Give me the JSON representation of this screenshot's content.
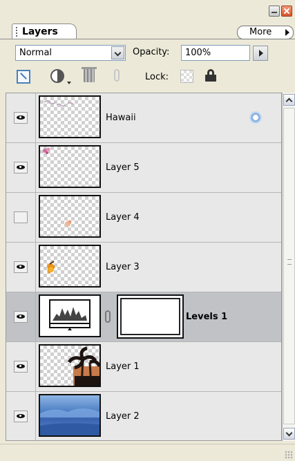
{
  "panel": {
    "tab_label": "Layers",
    "menu_label": "More"
  },
  "options": {
    "blend_mode": "Normal",
    "opacity_label": "Opacity:",
    "opacity_value": "100%",
    "lock_label": "Lock:"
  },
  "layers": [
    {
      "name": "Hawaii",
      "visible": true,
      "selected": false
    },
    {
      "name": "Layer 5",
      "visible": true,
      "selected": false
    },
    {
      "name": "Layer 4",
      "visible": false,
      "selected": false
    },
    {
      "name": "Layer 3",
      "visible": true,
      "selected": false
    },
    {
      "name": "Levels 1",
      "visible": true,
      "selected": true
    },
    {
      "name": "Layer 1",
      "visible": true,
      "selected": false
    },
    {
      "name": "Layer 2",
      "visible": true,
      "selected": false
    }
  ]
}
